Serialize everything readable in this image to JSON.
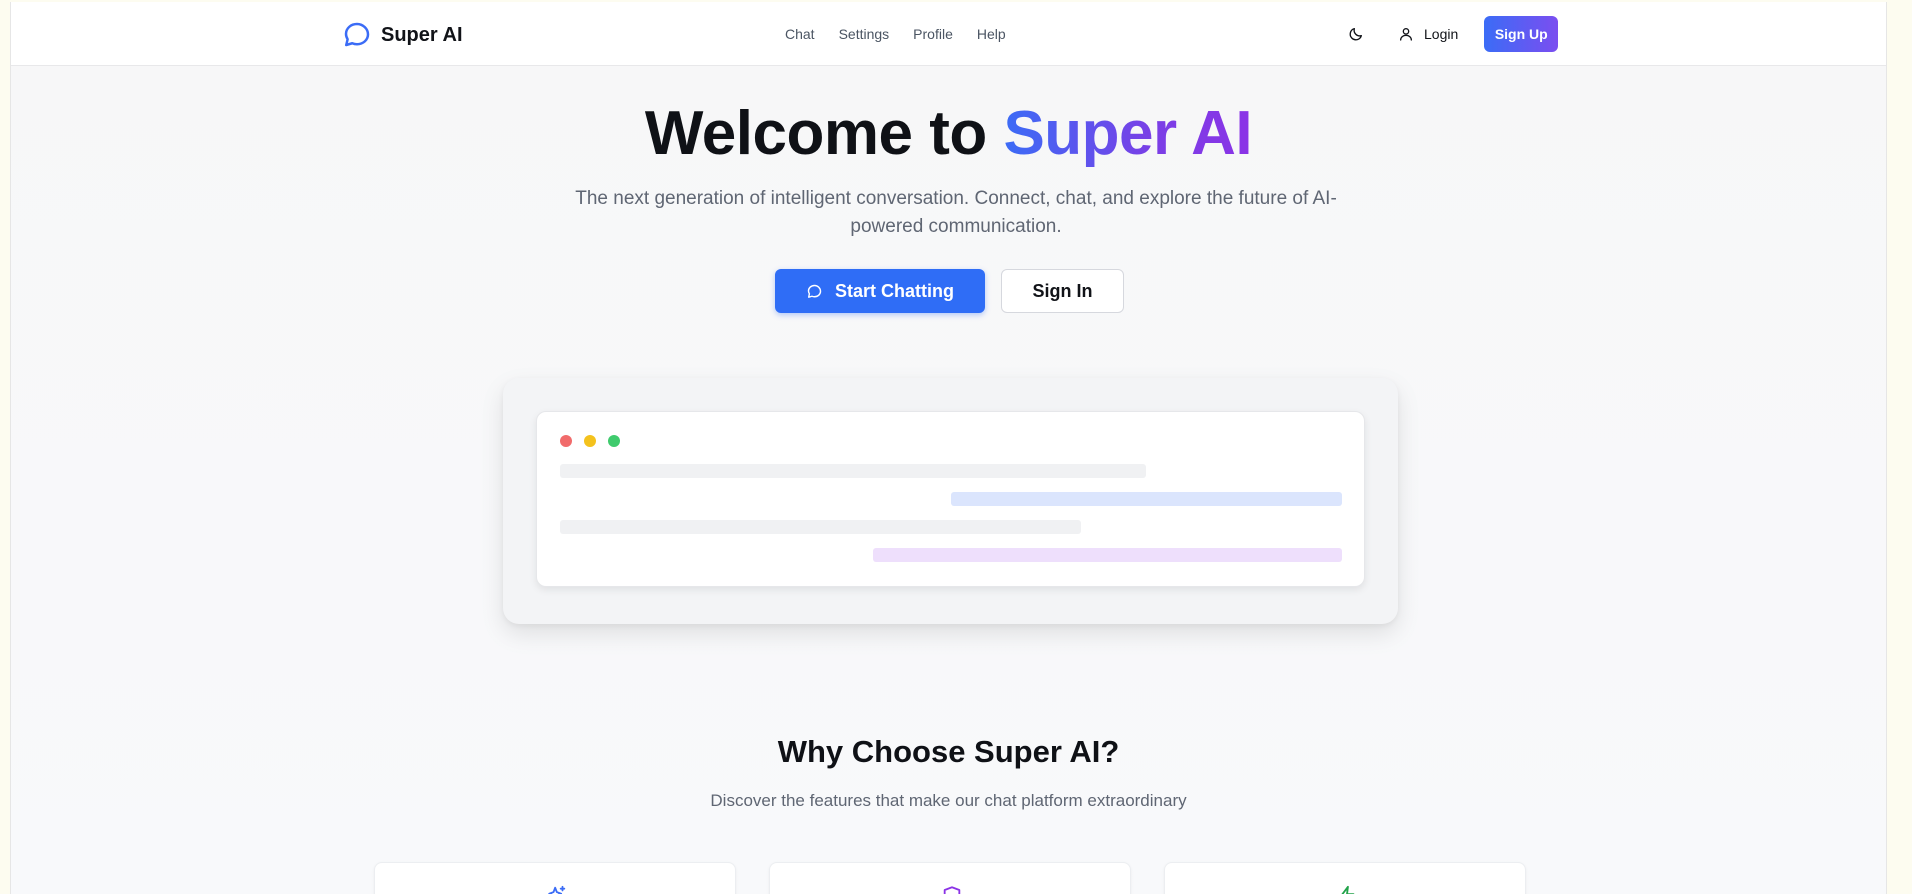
{
  "nav": {
    "brand": "Super AI",
    "menu": [
      {
        "label": "Chat"
      },
      {
        "label": "Settings"
      },
      {
        "label": "Profile"
      },
      {
        "label": "Help"
      }
    ],
    "login_label": "Login",
    "signup_label": "Sign Up"
  },
  "hero": {
    "title_prefix": "Welcome to ",
    "title_highlight": "Super AI",
    "subtitle": "The next generation of intelligent conversation. Connect, chat, and explore the future of AI-powered communication.",
    "primary_cta": "Start Chatting",
    "secondary_cta": "Sign In"
  },
  "features": {
    "title": "Why Choose Super AI?",
    "subtitle": "Discover the features that make our chat platform extraordinary",
    "cards": [
      {
        "icon": "sparkles-icon",
        "color": "#3b6cf6"
      },
      {
        "icon": "shield-icon",
        "color": "#8b33e6"
      },
      {
        "icon": "lightning-icon",
        "color": "#22a34a"
      }
    ]
  },
  "colors": {
    "primary": "#2f6df6",
    "accent_purple": "#7b4ef0",
    "text_dark": "#0f1116",
    "text_muted": "#5f6673"
  }
}
